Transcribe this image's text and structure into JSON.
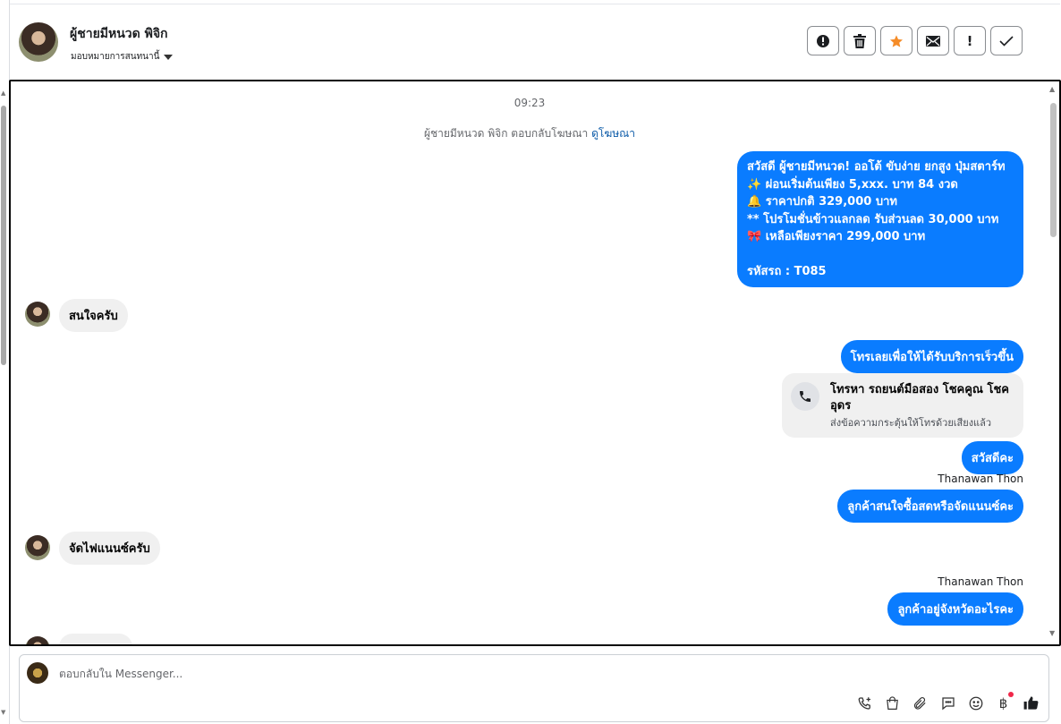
{
  "header": {
    "contact_name": "ผู้ชายมีหนวด พิจิก",
    "assign_label": "มอบหมายการสนทนานี้",
    "actions": [
      {
        "name": "report-spam",
        "icon": "alert-circle-icon"
      },
      {
        "name": "delete",
        "icon": "trash-icon"
      },
      {
        "name": "star",
        "icon": "star-icon"
      },
      {
        "name": "mark-unread",
        "icon": "envelope-icon",
        "label": "✉"
      },
      {
        "name": "follow-up",
        "icon": "exclamation-icon",
        "label": "!"
      },
      {
        "name": "mark-done",
        "icon": "check-icon",
        "label": "✓"
      }
    ]
  },
  "conversation": {
    "timestamp": "09:23",
    "ad_reply_text": "ผู้ชายมีหนวด พิจิก ตอบกลับโฆษณา",
    "ad_reply_link": "ดูโฆษณา",
    "ad_message_lines": [
      "สวัสดี ผู้ชายมีหนวด! ออโต้ ขับง่าย ยกสูง ปุ่มสตาร์ท",
      "✨ ผ่อนเริ่มต้นเพียง 5,xxx. บาท 84 งวด",
      "🔔 ราคาปกติ 329,000 บาท",
      "** โปรโมชั่นข้าวแลกลด รับส่วนลด 30,000 บาท",
      "🎀 เหลือเพียงราคา 299,000 บาท",
      "รหัสรถ : T085"
    ],
    "msg_in_1": "สนใจครับ",
    "msg_out_1": "โทรเลยเพื่อให้ได้รับบริการเร็วขึ้น",
    "call_card": {
      "title": "โทรหา รถยนต์มือสอง โชคคูณ โชค อุดร",
      "subtitle": "ส่งข้อความกระตุ้นให้โทรด้วยเสียงแล้ว"
    },
    "msg_out_2": "สวัสดีคะ",
    "sender_1": "Thanawan Thon",
    "msg_out_3": "ลูกค้าสนใจซื้อสดหรือจัดแนนซ์คะ",
    "msg_in_2": "จัดไฟแนนซ์ครับ",
    "sender_2": "Thanawan Thon",
    "msg_out_4": "ลูกค้าอยู่จังหวัดอะไรคะ"
  },
  "composer": {
    "placeholder": "ตอบกลับใน Messenger...",
    "tools": [
      "phone-plus-icon",
      "shopping-bag-icon",
      "paperclip-icon",
      "chat-bubble-icon",
      "smiley-icon",
      "baht-icon",
      "thumbs-up-icon"
    ]
  },
  "colors": {
    "outgoing_bubble": "#0a7cff",
    "incoming_bubble": "#f0f0f0",
    "star_accent": "#f58c28",
    "notification_dot": "#f02849"
  }
}
